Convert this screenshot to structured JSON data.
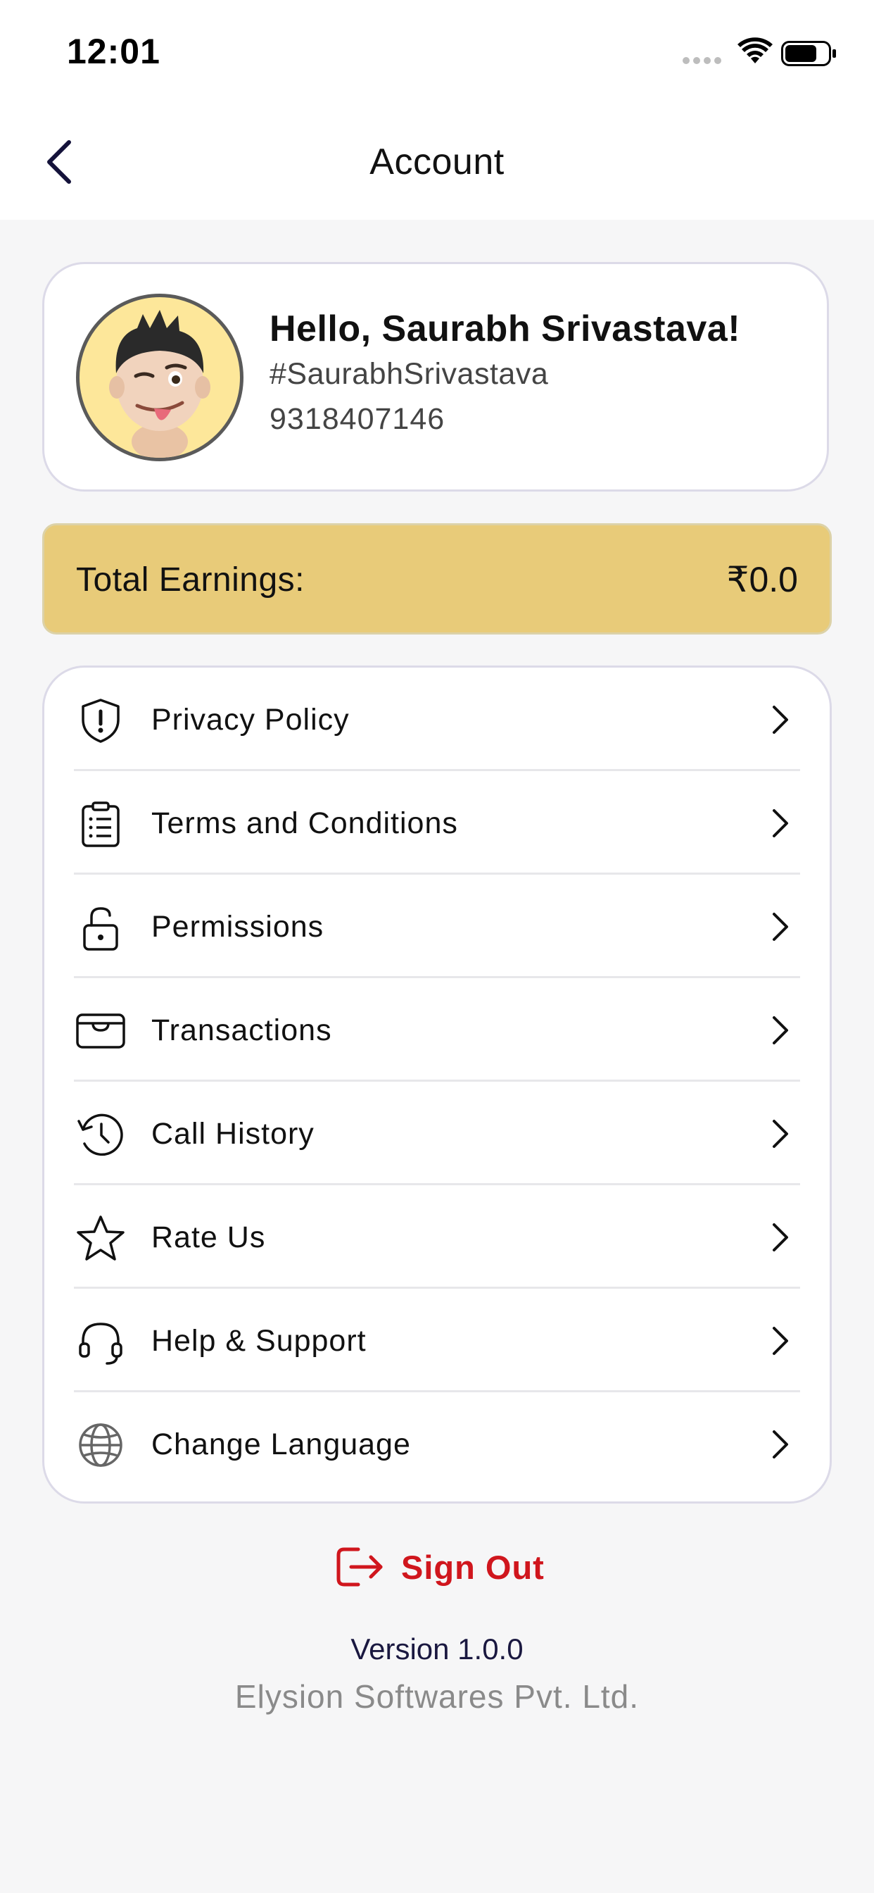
{
  "status_bar": {
    "time": "12:01"
  },
  "header": {
    "title": "Account",
    "back_icon": "chevron-left-icon"
  },
  "profile": {
    "greeting": "Hello, Saurabh Srivastava!",
    "handle": "#SaurabhSrivastava",
    "phone": "9318407146",
    "avatar": "memoji-avatar"
  },
  "earnings": {
    "label": "Total Earnings:",
    "value": "₹0.0"
  },
  "menu": {
    "items": [
      {
        "label": "Privacy Policy",
        "icon": "shield-alert-icon"
      },
      {
        "label": "Terms and Conditions",
        "icon": "clipboard-list-icon"
      },
      {
        "label": "Permissions",
        "icon": "unlock-icon"
      },
      {
        "label": "Transactions",
        "icon": "wallet-icon"
      },
      {
        "label": "Call History",
        "icon": "history-icon"
      },
      {
        "label": "Rate Us",
        "icon": "star-icon"
      },
      {
        "label": "Help & Support",
        "icon": "headset-icon"
      },
      {
        "label": "Change Language",
        "icon": "globe-icon"
      }
    ]
  },
  "signout": {
    "label": "Sign Out",
    "icon": "logout-icon"
  },
  "footer": {
    "version": "Version 1.0.0",
    "company": "Elysion Softwares Pvt. Ltd."
  },
  "colors": {
    "accent_gold": "#e8cb79",
    "danger": "#d0161d",
    "navy": "#1a1840"
  }
}
